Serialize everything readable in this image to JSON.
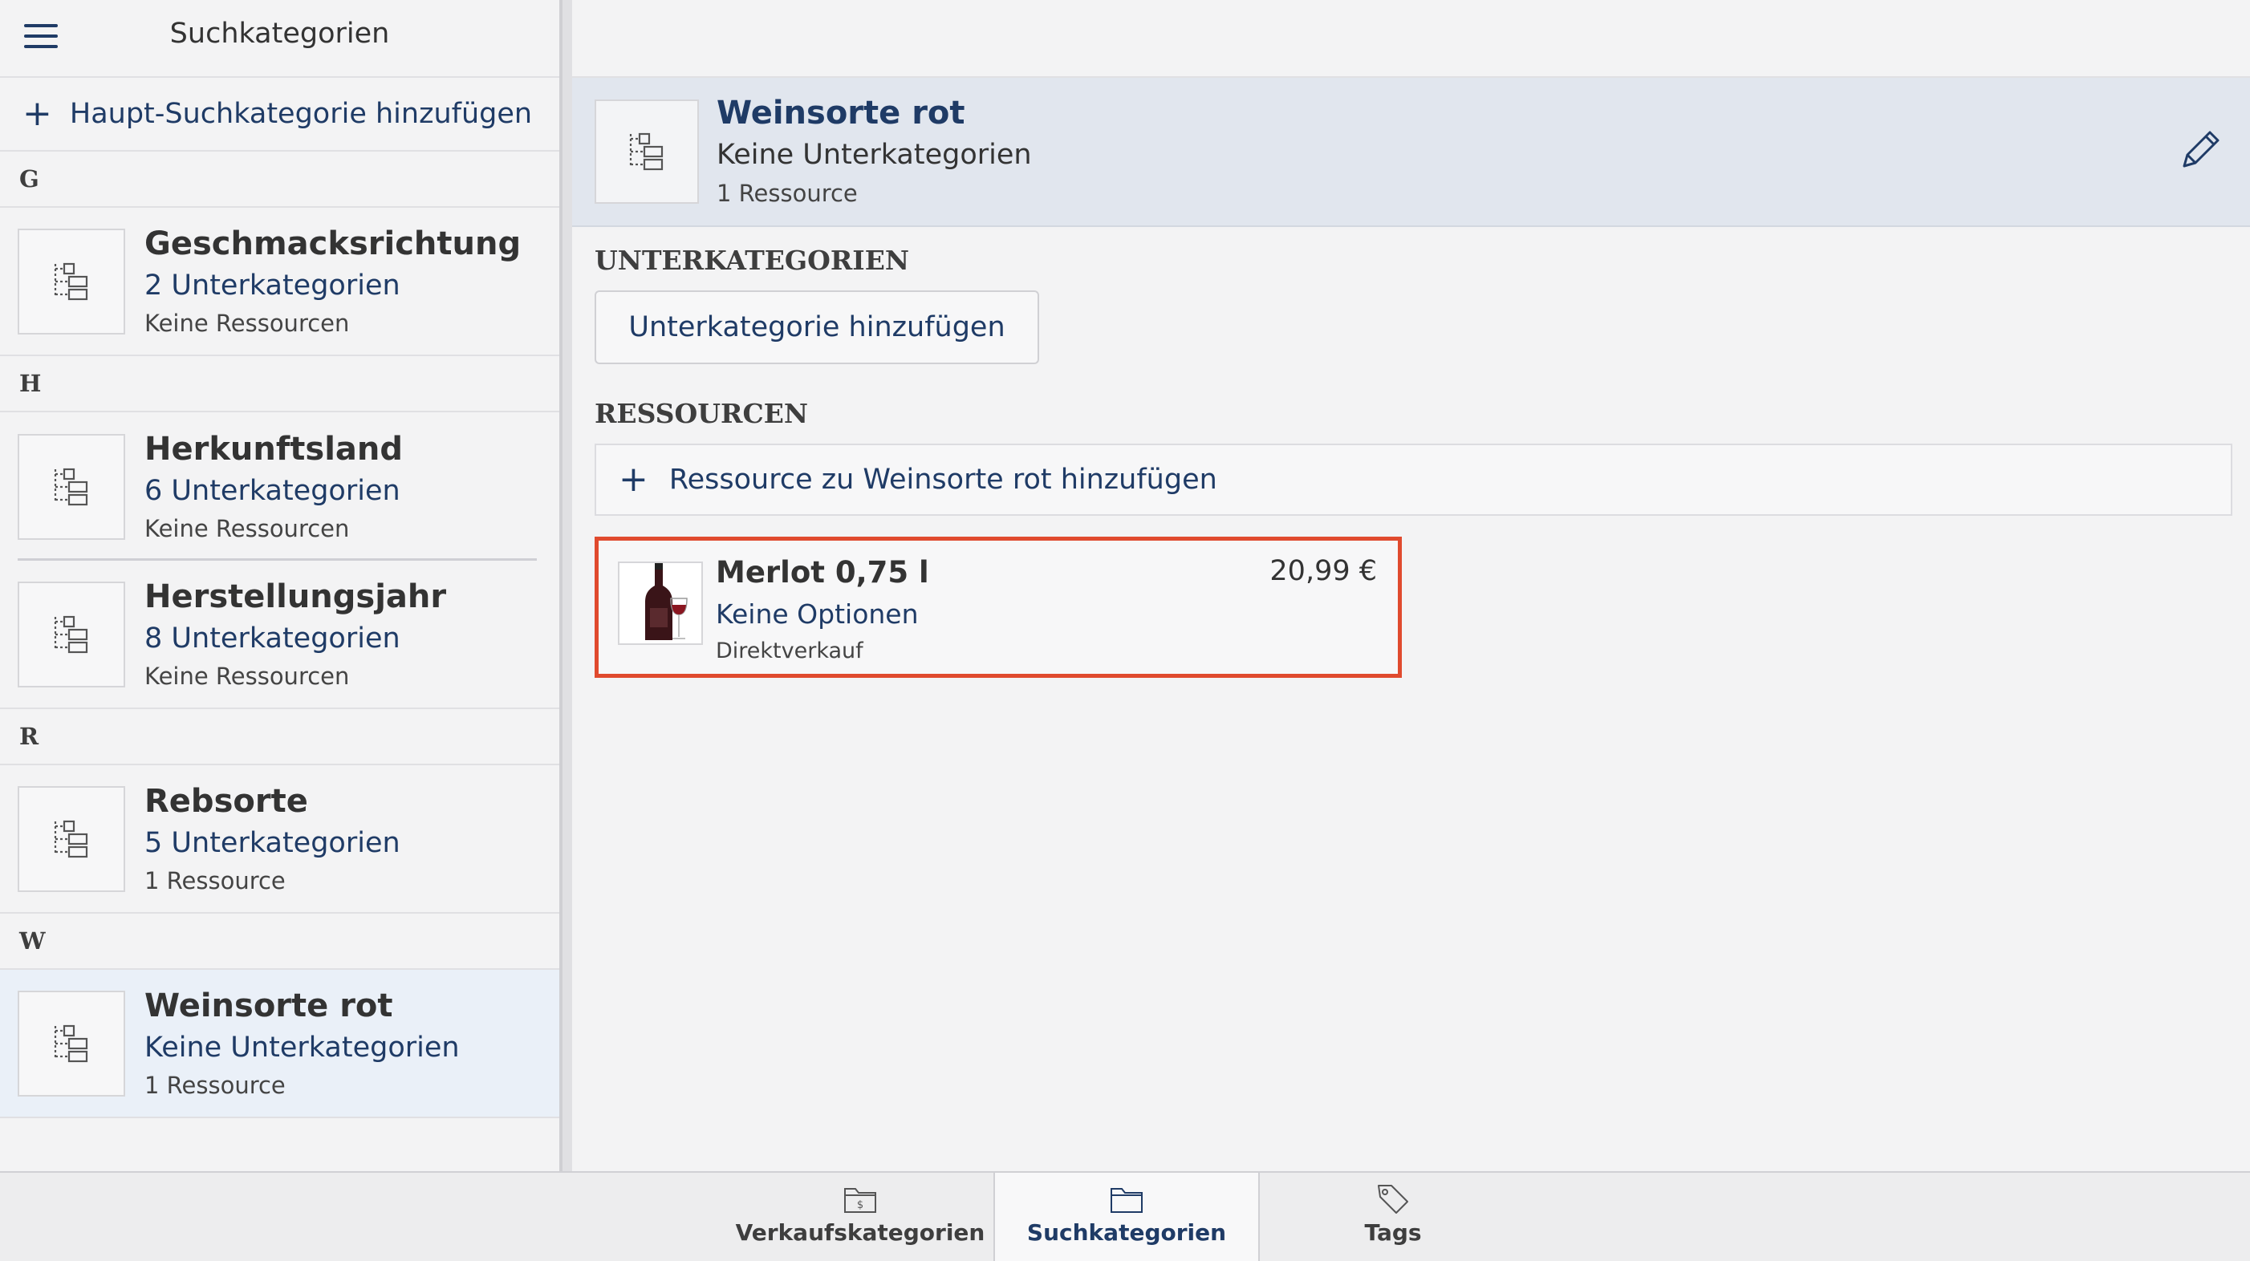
{
  "sidebar": {
    "title": "Suchkategorien",
    "add_label": "Haupt-Suchkategorie hinzufügen",
    "sections": [
      {
        "letter": "G",
        "items": [
          {
            "name": "Geschmacksrichtung",
            "sub": "2 Unterkategorien",
            "res": "Keine Ressourcen"
          }
        ]
      },
      {
        "letter": "H",
        "items": [
          {
            "name": "Herkunftsland",
            "sub": "6 Unterkategorien",
            "res": "Keine Ressourcen"
          },
          {
            "name": "Herstellungsjahr",
            "sub": "8 Unterkategorien",
            "res": "Keine Ressourcen"
          }
        ]
      },
      {
        "letter": "R",
        "items": [
          {
            "name": "Rebsorte",
            "sub": "5 Unterkategorien",
            "res": "1 Ressource"
          }
        ]
      },
      {
        "letter": "W",
        "items": [
          {
            "name": "Weinsorte rot",
            "sub": "Keine Unterkategorien",
            "res": "1 Ressource",
            "selected": true
          }
        ]
      }
    ]
  },
  "detail": {
    "title": "Weinsorte rot",
    "sub": "Keine Unterkategorien",
    "res": "1 Ressource",
    "subcategories_heading": "UNTERKATEGORIEN",
    "add_sub_label": "Unterkategorie hinzufügen",
    "resources_heading": "RESSOURCEN",
    "add_resource_label": "Ressource zu Weinsorte rot hinzufügen",
    "resource": {
      "name": "Merlot 0,75 l",
      "options": "Keine Optionen",
      "type": "Direktverkauf",
      "price": "20,99 €"
    }
  },
  "tabs": [
    {
      "label": "Verkaufskategorien",
      "icon": "folder-dollar-icon",
      "active": false
    },
    {
      "label": "Suchkategorien",
      "icon": "folder-icon",
      "active": true
    },
    {
      "label": "Tags",
      "icon": "tag-icon",
      "active": false
    }
  ],
  "colors": {
    "accent": "#1f3b66",
    "highlight": "#e04a2e",
    "selected_bg": "#eaf0f8"
  }
}
